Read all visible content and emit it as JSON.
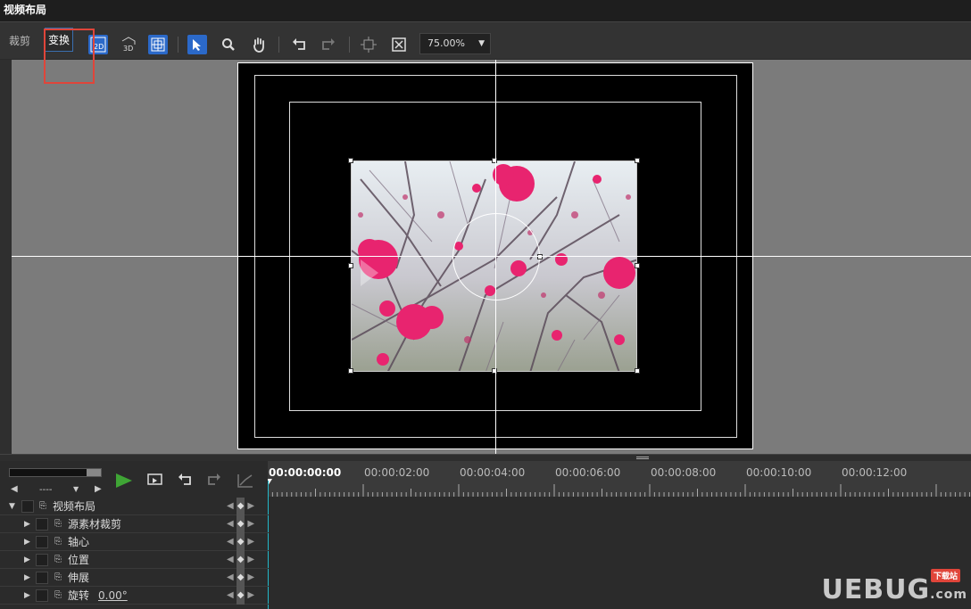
{
  "window": {
    "title": "视频布局"
  },
  "toolbar": {
    "tabs": [
      "裁剪",
      "变换"
    ],
    "buttons": {
      "mode2d": "2D",
      "mode3d": "3D",
      "grid": "grid-icon",
      "select": "arrow-cursor-icon",
      "zoom_tool": "magnifier-icon",
      "hand": "hand-icon",
      "undo": "undo-icon",
      "redo": "redo-icon",
      "fit_frame": "fit-frame-icon",
      "fit_full": "fit-full-icon"
    },
    "zoom_value": "75.00%"
  },
  "timeline": {
    "nav_select": "----",
    "timecodes": [
      "00:00:00:00",
      "00:00:02:00",
      "00:00:04:00",
      "00:00:06:00",
      "00:00:08:00",
      "00:00:10:00",
      "00:00:12:00"
    ],
    "tracks": [
      {
        "label": "视频布局",
        "level": 0,
        "expanded": true
      },
      {
        "label": "源素材裁剪",
        "level": 1
      },
      {
        "label": "轴心",
        "level": 1
      },
      {
        "label": "位置",
        "level": 1
      },
      {
        "label": "伸展",
        "level": 1
      },
      {
        "label": "旋转",
        "level": 1,
        "value": "0.00°"
      }
    ]
  },
  "watermark": {
    "brand": "UEBUG",
    "suffix": ".com",
    "badge": "下载站"
  },
  "colors": {
    "accent": "#2b69c9",
    "highlight": "#e0453a",
    "playhead": "#23b8c9",
    "play": "#3fa535"
  }
}
